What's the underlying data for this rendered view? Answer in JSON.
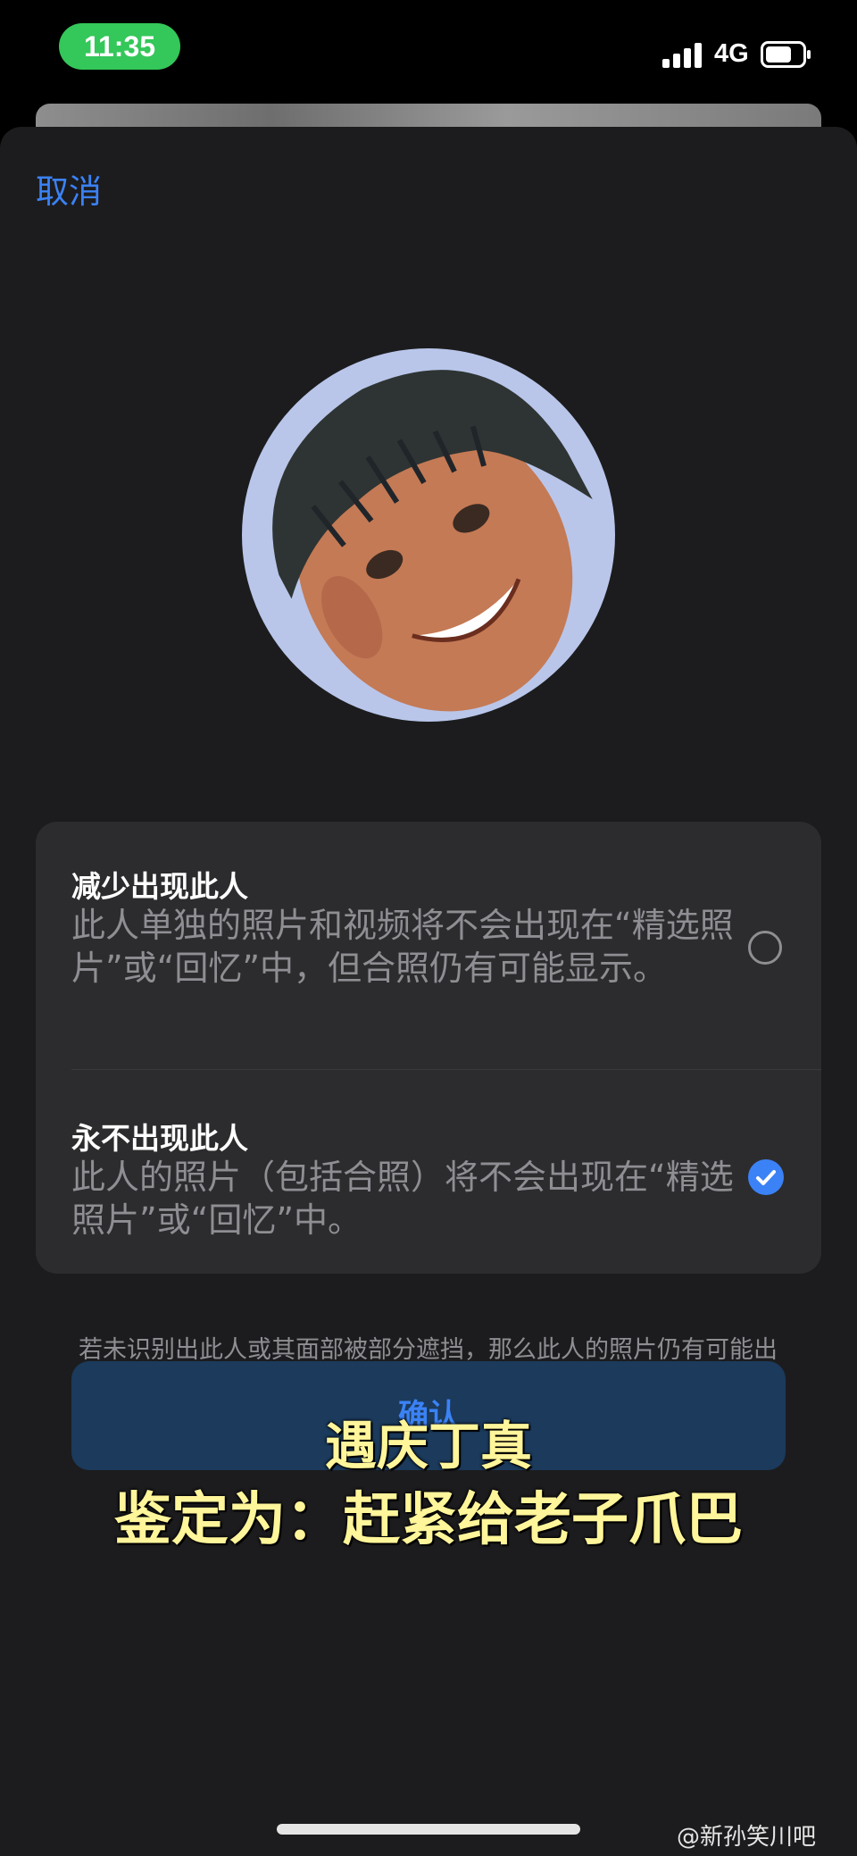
{
  "status_bar": {
    "time": "11:35",
    "network": "4G",
    "time_pill_color": "#34c759",
    "icons": [
      "signal-icon",
      "battery-icon"
    ]
  },
  "sheet": {
    "cancel_label": "取消",
    "options": [
      {
        "title": "减少出现此人",
        "description": "此人单独的照片和视频将不会出现在“精选照片”或“回忆”中，但合照仍有可能显示。",
        "selected": false
      },
      {
        "title": "永不出现此人",
        "description": "此人的照片（包括合照）将不会出现在“精选照片”或“回忆”中。",
        "selected": true
      }
    ],
    "footnote": "若未识别出此人或其面部被部分遮挡，那么此人的照片仍有可能出现。",
    "confirm_label": "确认",
    "accent_color": "#3b82f6"
  },
  "overlay": {
    "line1": "遇庆丁真",
    "line2": "鉴定为：赶紧给老子爪巴"
  },
  "watermark": "@新孙笑川吧"
}
